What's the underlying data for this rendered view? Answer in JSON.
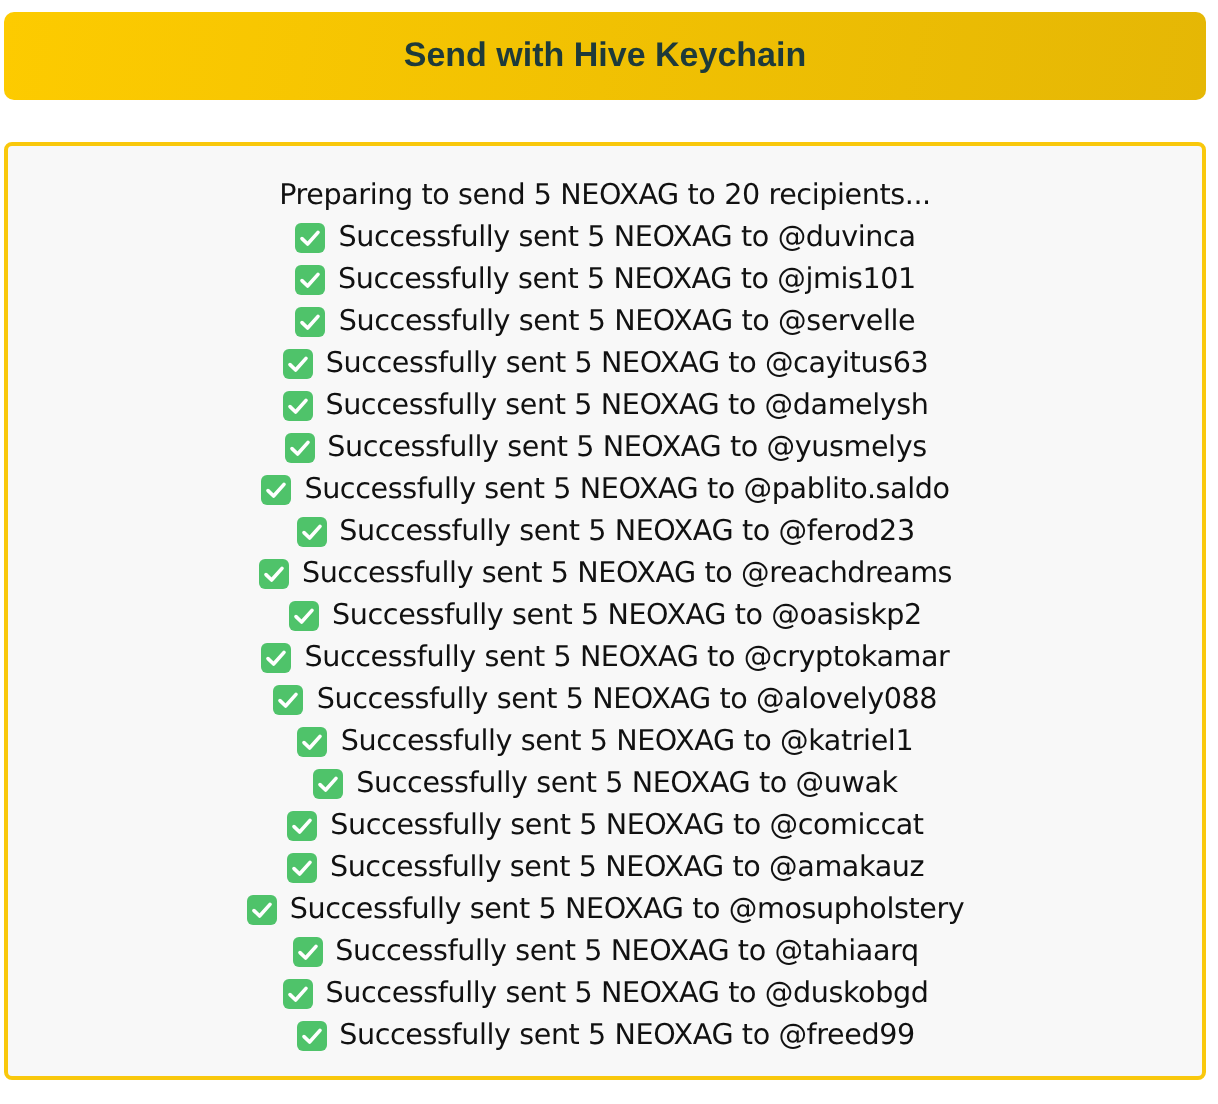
{
  "send_button": {
    "label": "Send with Hive Keychain"
  },
  "log": {
    "header": "Preparing to send 5 NEOXAG to 20 recipients...",
    "entries": [
      "Successfully sent 5 NEOXAG to @duvinca",
      "Successfully sent 5 NEOXAG to @jmis101",
      "Successfully sent 5 NEOXAG to @servelle",
      "Successfully sent 5 NEOXAG to @cayitus63",
      "Successfully sent 5 NEOXAG to @damelysh",
      "Successfully sent 5 NEOXAG to @yusmelys",
      "Successfully sent 5 NEOXAG to @pablito.saldo",
      "Successfully sent 5 NEOXAG to @ferod23",
      "Successfully sent 5 NEOXAG to @reachdreams",
      "Successfully sent 5 NEOXAG to @oasiskp2",
      "Successfully sent 5 NEOXAG to @cryptokamar",
      "Successfully sent 5 NEOXAG to @alovely088",
      "Successfully sent 5 NEOXAG to @katriel1",
      "Successfully sent 5 NEOXAG to @uwak",
      "Successfully sent 5 NEOXAG to @comiccat",
      "Successfully sent 5 NEOXAG to @amakauz",
      "Successfully sent 5 NEOXAG to @mosupholstery",
      "Successfully sent 5 NEOXAG to @tahiaarq",
      "Successfully sent 5 NEOXAG to @duskobgd",
      "Successfully sent 5 NEOXAG to @freed99"
    ]
  }
}
